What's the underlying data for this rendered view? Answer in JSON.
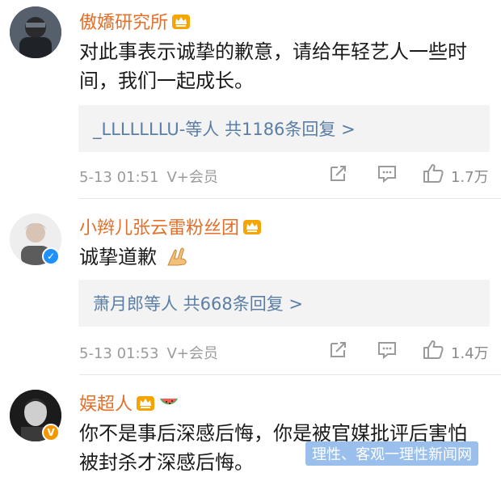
{
  "comments": [
    {
      "username": "傲嬌研究所",
      "text": "对此事表示诚挚的歉意，请给年轻艺人一些时间，我们一起成长。",
      "replies": "_LLLLLLLU-等人  共1186条回复 >",
      "date": "5-13 01:51",
      "member": "V+会员",
      "likes": "1.7万"
    },
    {
      "username": "小辫儿张云雷粉丝团",
      "text": "诚挚道歉",
      "replies": "萧月郎等人  共668条回复 >",
      "date": "5-13 01:53",
      "member": "V+会员",
      "likes": "1.4万"
    },
    {
      "username": "娱超人",
      "text": "你不是事后深感后悔，你是被官媒批评后害怕被封杀才深感后悔。"
    }
  ],
  "icons": {
    "crown": "crown-icon",
    "verified": "verified-badge-icon",
    "share": "share-icon",
    "comment": "comment-icon",
    "like": "like-icon",
    "pray": "pray-emoji-icon",
    "watermelon": "watermelon-emoji-icon"
  },
  "colors": {
    "username": "#e36f2a",
    "link": "#5a7ea6",
    "meta": "#9b9b9b",
    "reply_bg": "#f3f3f3"
  },
  "watermark": "理性、客观一理性新闻网"
}
